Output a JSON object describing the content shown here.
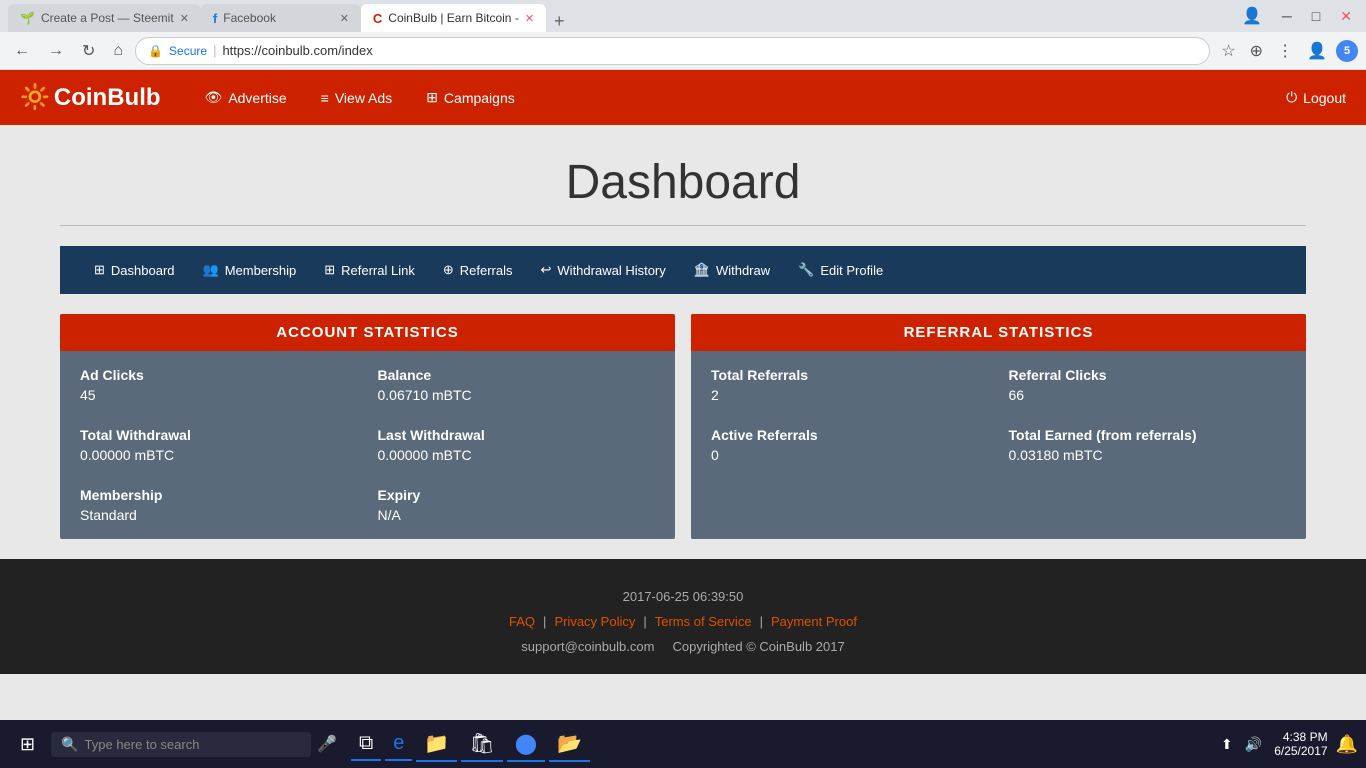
{
  "browser": {
    "tabs": [
      {
        "label": "Create a Post — Steemit",
        "favicon": "🌱",
        "active": false,
        "id": "steemit"
      },
      {
        "label": "Facebook",
        "favicon": "f",
        "active": false,
        "id": "facebook"
      },
      {
        "label": "CoinBulb | Earn Bitcoin -",
        "favicon": "C",
        "active": true,
        "id": "coinbulb"
      }
    ],
    "address": "https://coinbulb.com/index",
    "secure_label": "Secure"
  },
  "navbar": {
    "brand": "CoinBulb",
    "items": [
      {
        "label": "Advertise",
        "icon": "👁"
      },
      {
        "label": "View Ads",
        "icon": "≡"
      },
      {
        "label": "Campaigns",
        "icon": "⊞"
      }
    ],
    "logout_label": "Logout"
  },
  "dashboard": {
    "title": "Dashboard",
    "tabs": [
      {
        "label": "Dashboard",
        "icon": "⊞"
      },
      {
        "label": "Membership",
        "icon": "👥"
      },
      {
        "label": "Referral Link",
        "icon": "⊞"
      },
      {
        "label": "Referrals",
        "icon": "⊕"
      },
      {
        "label": "Withdrawal History",
        "icon": "↩"
      },
      {
        "label": "Withdraw",
        "icon": "🏦"
      },
      {
        "label": "Edit Profile",
        "icon": "🔧"
      }
    ]
  },
  "account_stats": {
    "header": "ACCOUNT STATISTICS",
    "items": [
      {
        "label": "Ad Clicks",
        "value": "45"
      },
      {
        "label": "Balance",
        "value": "0.06710 mBTC"
      },
      {
        "label": "Total Withdrawal",
        "value": "0.00000 mBTC"
      },
      {
        "label": "Last Withdrawal",
        "value": "0.00000 mBTC"
      },
      {
        "label": "Membership",
        "value": "Standard"
      },
      {
        "label": "Expiry",
        "value": "N/A"
      }
    ]
  },
  "referral_stats": {
    "header": "REFERRAL STATISTICS",
    "items": [
      {
        "label": "Total Referrals",
        "value": "2"
      },
      {
        "label": "Referral Clicks",
        "value": "66"
      },
      {
        "label": "Active Referrals",
        "value": "0"
      },
      {
        "label": "Total Earned (from referrals)",
        "value": "0.03180 mBTC"
      }
    ]
  },
  "footer": {
    "timestamp": "2017-06-25 06:39:50",
    "links": [
      "FAQ",
      "Privacy Policy",
      "Terms of Service",
      "Payment Proof"
    ],
    "support": "support@coinbulb.com",
    "copyright": "Copyrighted © CoinBulb 2017"
  },
  "taskbar": {
    "search_placeholder": "Type here to search",
    "time": "4:38 PM",
    "date": "6/25/2017"
  }
}
